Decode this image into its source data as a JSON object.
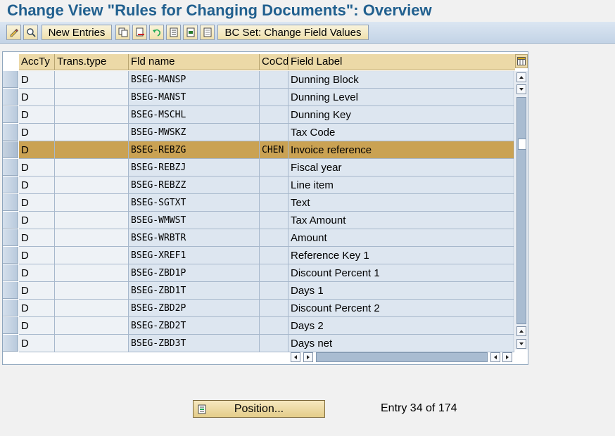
{
  "title": "Change View \"Rules for Changing Documents\": Overview",
  "toolbar": {
    "new_entries_label": "New Entries",
    "bc_set_label": "BC Set: Change Field Values",
    "icons": [
      "display-change-icon",
      "details-icon",
      "copy-icon",
      "delete-icon",
      "undo-icon",
      "select-all-icon",
      "select-block-icon",
      "deselect-all-icon"
    ]
  },
  "table": {
    "columns": [
      "AccTy",
      "Trans.type",
      "Fld name",
      "CoCd",
      "Field Label"
    ],
    "rows": [
      {
        "accty": "D",
        "trans": "",
        "fld": "BSEG-MANSP",
        "cocd": "",
        "label": "Dunning Block"
      },
      {
        "accty": "D",
        "trans": "",
        "fld": "BSEG-MANST",
        "cocd": "",
        "label": "Dunning Level"
      },
      {
        "accty": "D",
        "trans": "",
        "fld": "BSEG-MSCHL",
        "cocd": "",
        "label": "Dunning Key"
      },
      {
        "accty": "D",
        "trans": "",
        "fld": "BSEG-MWSKZ",
        "cocd": "",
        "label": "Tax Code"
      },
      {
        "accty": "D",
        "trans": "",
        "fld": "BSEG-REBZG",
        "cocd": "CHEN",
        "label": "Invoice reference",
        "selected": true
      },
      {
        "accty": "D",
        "trans": "",
        "fld": "BSEG-REBZJ",
        "cocd": "",
        "label": "Fiscal year"
      },
      {
        "accty": "D",
        "trans": "",
        "fld": "BSEG-REBZZ",
        "cocd": "",
        "label": "Line item"
      },
      {
        "accty": "D",
        "trans": "",
        "fld": "BSEG-SGTXT",
        "cocd": "",
        "label": "Text"
      },
      {
        "accty": "D",
        "trans": "",
        "fld": "BSEG-WMWST",
        "cocd": "",
        "label": "Tax Amount"
      },
      {
        "accty": "D",
        "trans": "",
        "fld": "BSEG-WRBTR",
        "cocd": "",
        "label": "Amount"
      },
      {
        "accty": "D",
        "trans": "",
        "fld": "BSEG-XREF1",
        "cocd": "",
        "label": "Reference Key 1"
      },
      {
        "accty": "D",
        "trans": "",
        "fld": "BSEG-ZBD1P",
        "cocd": "",
        "label": "Discount Percent 1"
      },
      {
        "accty": "D",
        "trans": "",
        "fld": "BSEG-ZBD1T",
        "cocd": "",
        "label": "Days 1"
      },
      {
        "accty": "D",
        "trans": "",
        "fld": "BSEG-ZBD2P",
        "cocd": "",
        "label": "Discount Percent 2"
      },
      {
        "accty": "D",
        "trans": "",
        "fld": "BSEG-ZBD2T",
        "cocd": "",
        "label": "Days 2"
      },
      {
        "accty": "D",
        "trans": "",
        "fld": "BSEG-ZBD3T",
        "cocd": "",
        "label": "Days net"
      }
    ]
  },
  "footer": {
    "position_label": "Position...",
    "entry_info": "Entry 34 of 174"
  },
  "colors": {
    "title": "#21608f",
    "selected_row": "#caa253",
    "header": "#ecd9a7",
    "cell": "#dde6f0"
  }
}
